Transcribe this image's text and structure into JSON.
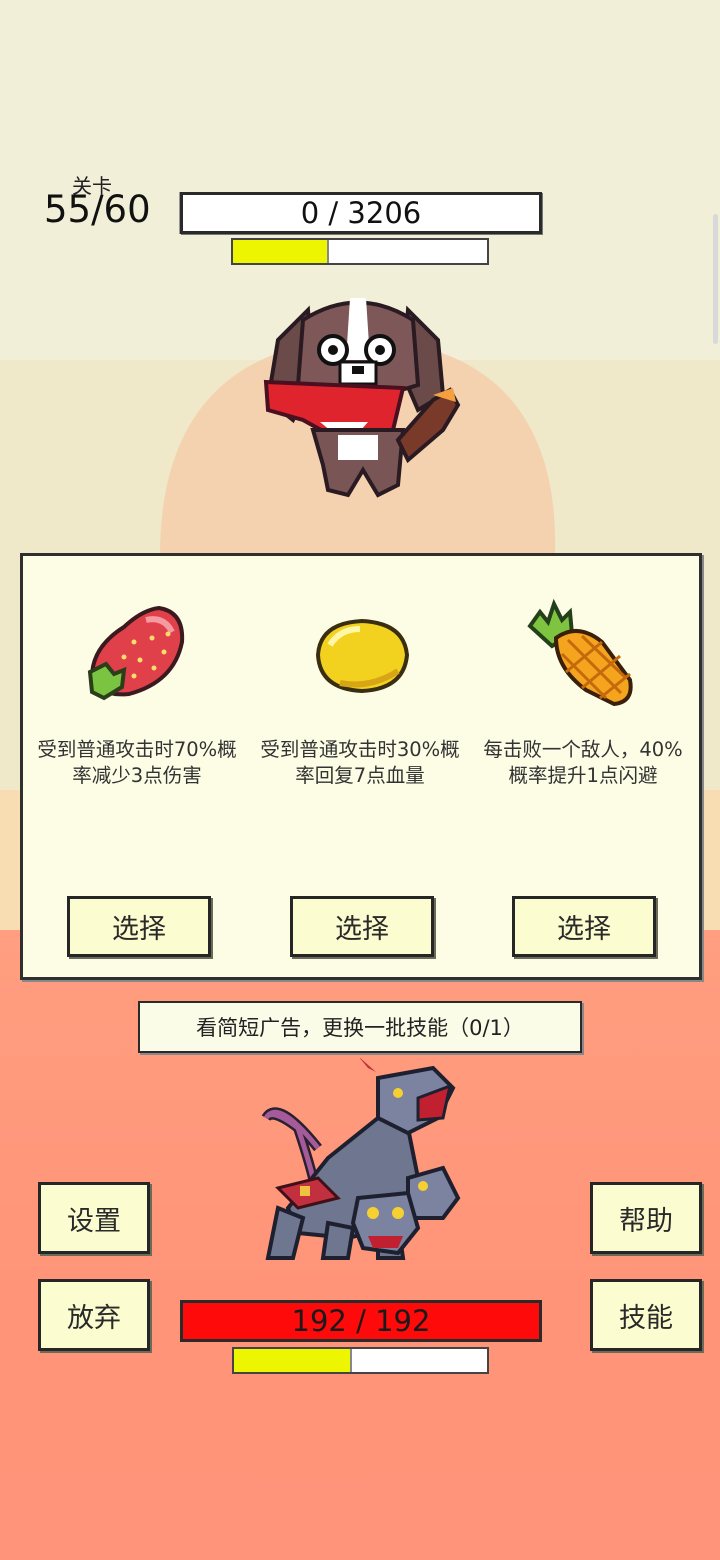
{
  "hud": {
    "stage_label": "关卡",
    "stage_value": "55/60",
    "boss_hp_text": "0 / 3206",
    "boss_progress": 0.37
  },
  "skills": [
    {
      "icon": "strawberry-icon",
      "description": "受到普通攻击时70%概率减少3点伤害",
      "select_label": "选择"
    },
    {
      "icon": "lemon-icon",
      "description": "受到普通攻击时30%概率回复7点血量",
      "select_label": "选择"
    },
    {
      "icon": "pineapple-icon",
      "description": "每击败一个敌人，40%概率提升1点闪避",
      "select_label": "选择"
    }
  ],
  "ad_banner_label": "看简短广告，更换一批技能（0/1）",
  "buttons": {
    "settings": "设置",
    "help": "帮助",
    "give_up": "放弃",
    "skills": "技能"
  },
  "player": {
    "hp_text": "192 / 192",
    "progress": 0.46
  },
  "colors": {
    "hp_red": "#ff0a0a",
    "progress_yellow": "#eef500",
    "button_bg": "#fbfccf"
  }
}
